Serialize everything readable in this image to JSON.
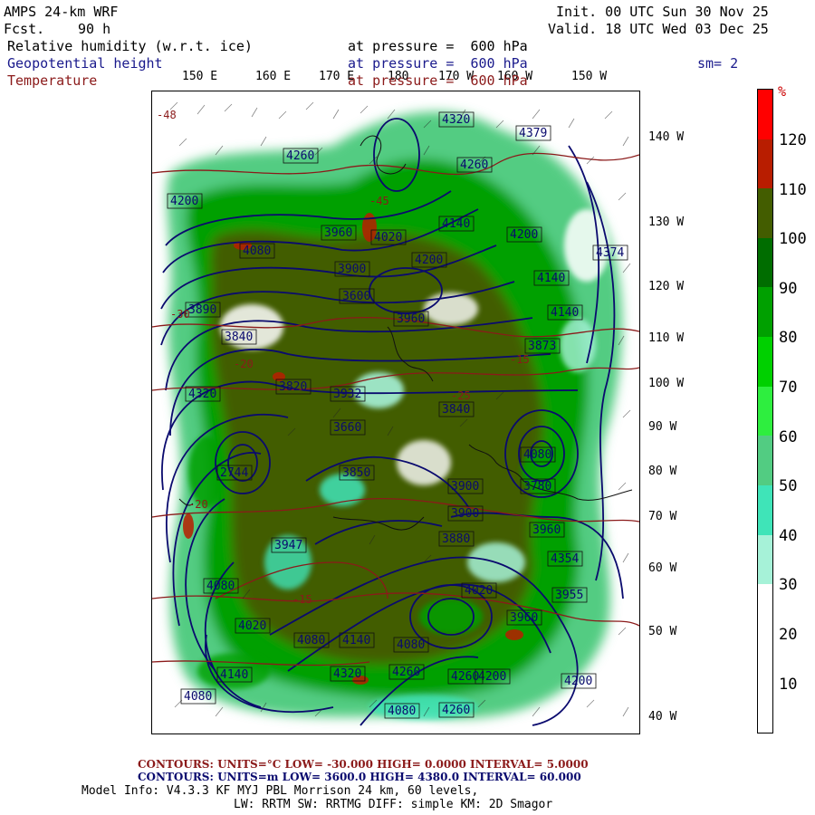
{
  "header": {
    "model": "AMPS 24-km WRF",
    "fcst_label": "Fcst.",
    "fcst_value": "90 h",
    "init": "Init. 00 UTC Sun 30 Nov 25",
    "valid": "Valid. 18 UTC Wed 03 Dec 25",
    "fields": [
      {
        "name": "Relative humidity (w.r.t. ice)",
        "level": "at pressure =  600 hPa"
      },
      {
        "name": "Geopotential height",
        "level": "at pressure =  600 hPa"
      },
      {
        "name": "Temperature",
        "level": "at pressure =  600 hPa"
      }
    ],
    "smooth": "sm= 2"
  },
  "longitude_labels": [
    "150 E",
    "160 E",
    "170 E",
    "180",
    "170 W",
    "160 W",
    "150 W"
  ],
  "latitude_labels": [
    "140 W",
    "130 W",
    "120 W",
    "110 W",
    "100 W",
    "90 W",
    "80 W",
    "70 W",
    "60 W",
    "50 W",
    "40 W"
  ],
  "colorbar": {
    "unit": "%",
    "ticks": [
      "120",
      "110",
      "100",
      "90",
      "80",
      "70",
      "60",
      "50",
      "40",
      "30",
      "20",
      "10"
    ],
    "colors": [
      "#ff0000",
      "#b81d00",
      "#435d00",
      "#006d00",
      "#00a000",
      "#00d000",
      "#2eee3f",
      "#52cc82",
      "#3fe4b8",
      "#a6f2d8",
      "#ffffff",
      "#ffffff",
      "#ffffff"
    ]
  },
  "map_labels": {
    "heights": [
      "4320",
      "4379",
      "4260",
      "4260",
      "4200",
      "4140",
      "4020",
      "4200",
      "4374",
      "4080",
      "3960",
      "4200",
      "3890",
      "3840",
      "3900",
      "4140",
      "3600",
      "3960",
      "3873",
      "3820",
      "3932",
      "3840",
      "2744",
      "3660",
      "3850",
      "3900",
      "3780",
      "3900",
      "3960",
      "3947",
      "3880",
      "3955",
      "4080",
      "4020",
      "4080",
      "4140",
      "4080",
      "4020",
      "3960",
      "4080",
      "4140",
      "4320",
      "4260",
      "4200",
      "4080",
      "4260",
      "4200",
      "4080",
      "4320",
      "4140",
      "4260",
      "4354"
    ],
    "temps": [
      "-48",
      "-45",
      "-20",
      "-15",
      "-20",
      "-25",
      "-30",
      "-15"
    ]
  },
  "footer": {
    "red_line": "CONTOURS:  UNITS=°C  LOW= -30.000      HIGH=  0.0000      INTERVAL=   5.0000",
    "blue_line": "CONTOURS:  UNITS=m  LOW=  3600.0       HIGH=  4380.0       INTERVAL=    60.000",
    "model_info": "Model Info: V4.3.3    KF      MYJ PBL  Morrison           24 km,    60 levels,",
    "model_info2": "LW: RRTM SW: RRTMG   DIFF: simple KM: 2D Smagor"
  },
  "colors": {
    "contour_height": "#0a0a6e",
    "contour_temp": "#8b1a1a",
    "rh_dark": "#435d00",
    "rh_green": "#00a000",
    "rh_teal": "#3fe4b8"
  }
}
